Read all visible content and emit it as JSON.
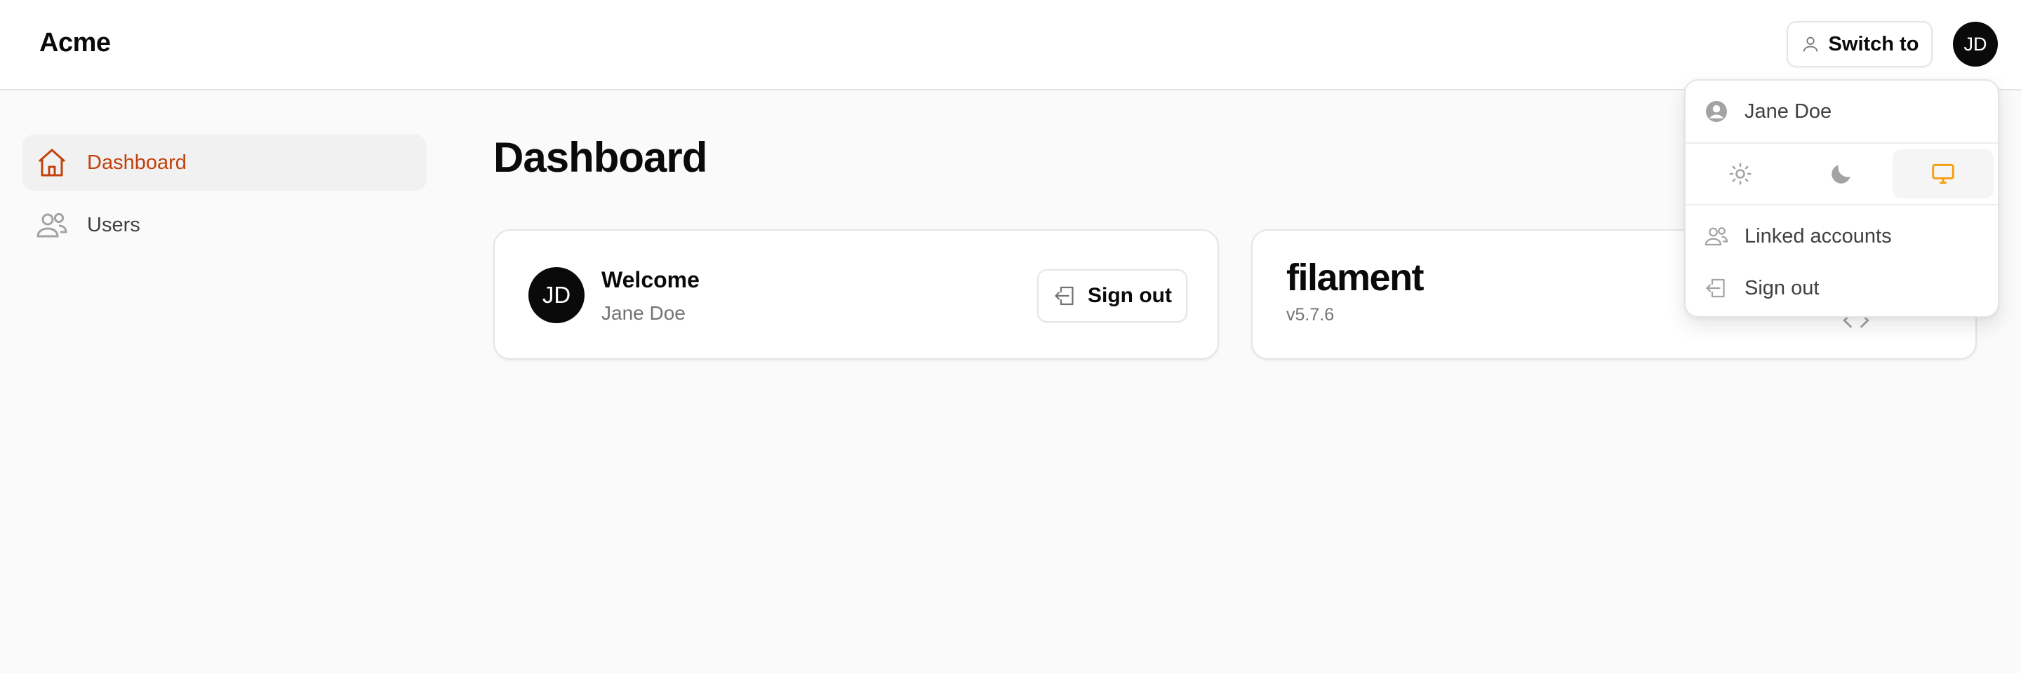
{
  "app": {
    "brand": "Acme"
  },
  "header": {
    "switch_label": "Switch to",
    "avatar_initials": "JD"
  },
  "sidebar": {
    "items": [
      {
        "label": "Dashboard",
        "icon": "home-icon",
        "active": true
      },
      {
        "label": "Users",
        "icon": "users-icon",
        "active": false
      }
    ]
  },
  "main": {
    "title": "Dashboard",
    "welcome_card": {
      "avatar_initials": "JD",
      "title": "Welcome",
      "name": "Jane Doe",
      "signout_label": "Sign out"
    },
    "filament_card": {
      "logo_text": "filament",
      "version": "v5.7.6"
    }
  },
  "user_menu": {
    "name": "Jane Doe",
    "theme_options": [
      {
        "icon": "sun-icon",
        "active": false
      },
      {
        "icon": "moon-icon",
        "active": false
      },
      {
        "icon": "monitor-icon",
        "active": true
      }
    ],
    "linked_accounts_label": "Linked accounts",
    "signout_label": "Sign out"
  },
  "colors": {
    "accent": "#c2410c",
    "theme_active": "#f59e0b",
    "icon_gray": "#a3a3a3"
  }
}
